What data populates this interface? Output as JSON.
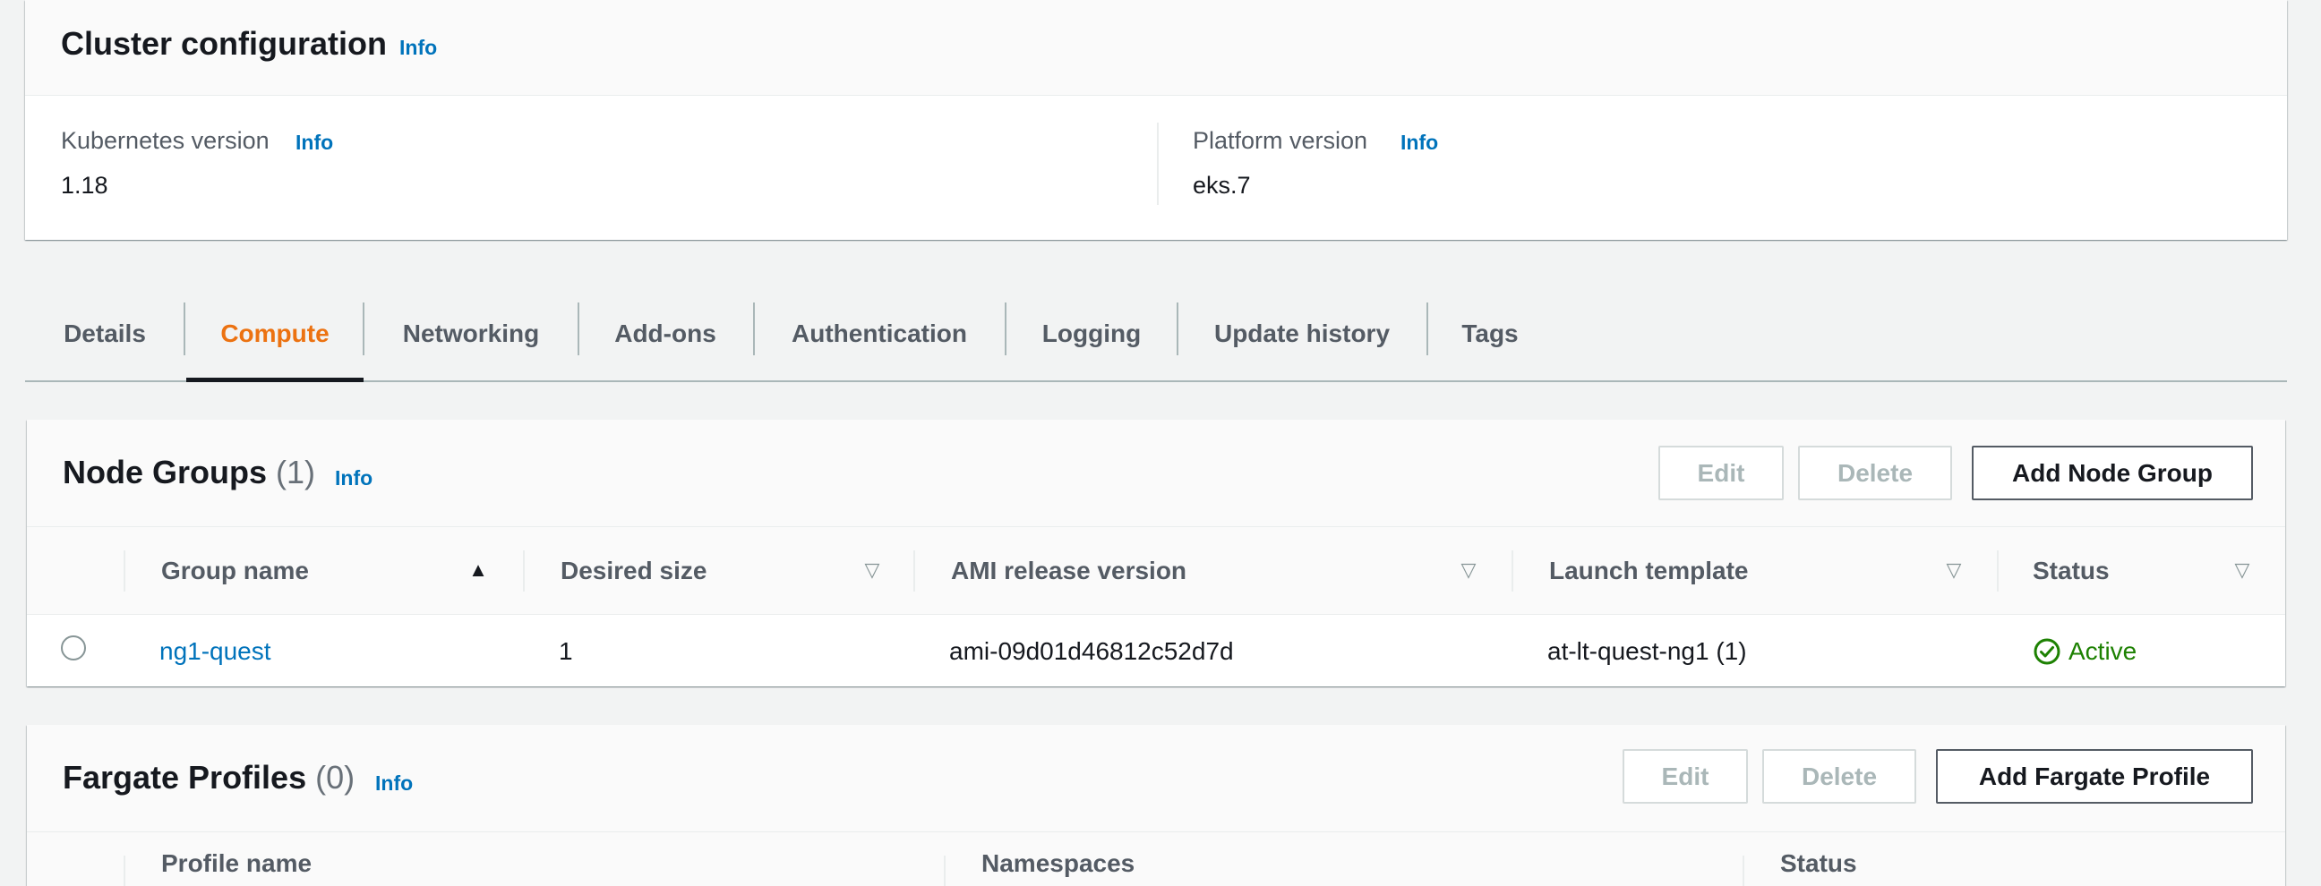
{
  "cluster_config": {
    "title": "Cluster configuration",
    "info": "Info",
    "kubernetes_version": {
      "label": "Kubernetes version",
      "info": "Info",
      "value": "1.18"
    },
    "platform_version": {
      "label": "Platform version",
      "info": "Info",
      "value": "eks.7"
    }
  },
  "tabs": [
    {
      "label": "Details",
      "active": false
    },
    {
      "label": "Compute",
      "active": true
    },
    {
      "label": "Networking",
      "active": false
    },
    {
      "label": "Add-ons",
      "active": false
    },
    {
      "label": "Authentication",
      "active": false
    },
    {
      "label": "Logging",
      "active": false
    },
    {
      "label": "Update history",
      "active": false
    },
    {
      "label": "Tags",
      "active": false
    }
  ],
  "node_groups": {
    "title": "Node Groups",
    "count": "(1)",
    "info": "Info",
    "buttons": {
      "edit": "Edit",
      "delete": "Delete",
      "add": "Add Node Group"
    },
    "columns": [
      "Group name",
      "Desired size",
      "AMI release version",
      "Launch template",
      "Status"
    ],
    "rows": [
      {
        "group_name": "ng1-quest",
        "desired_size": "1",
        "ami_release_version": "ami-09d01d46812c52d7d",
        "launch_template": "at-lt-quest-ng1 (1)",
        "status": "Active"
      }
    ]
  },
  "fargate_profiles": {
    "title": "Fargate Profiles",
    "count": "(0)",
    "info": "Info",
    "buttons": {
      "edit": "Edit",
      "delete": "Delete",
      "add": "Add Fargate Profile"
    },
    "columns": [
      "Profile name",
      "Namespaces",
      "Status"
    ]
  },
  "colors": {
    "accent_tab": "#ec7211",
    "link": "#0073bb",
    "status_active": "#1d8102"
  },
  "icons": {
    "sort_asc": "caret-up-icon",
    "sort_none": "caret-down-outline-icon",
    "status_active": "check-circle-icon"
  }
}
